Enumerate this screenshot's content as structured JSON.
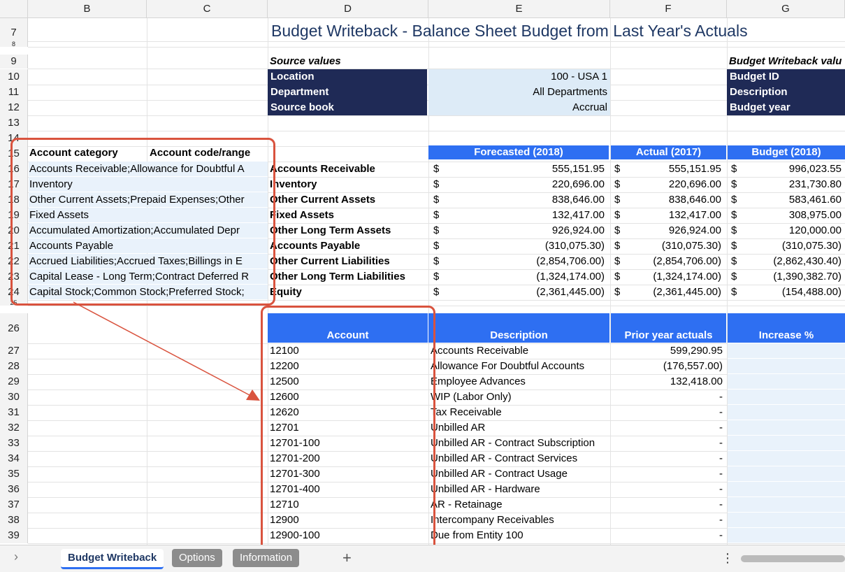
{
  "columns": [
    "B",
    "C",
    "D",
    "E",
    "F",
    "G"
  ],
  "rows": [
    "7",
    "8",
    "9",
    "10",
    "11",
    "12",
    "13",
    "14",
    "15",
    "16",
    "17",
    "18",
    "19",
    "20",
    "21",
    "22",
    "23",
    "24",
    "25",
    "26",
    "27",
    "28",
    "29",
    "30",
    "31",
    "32",
    "33",
    "34",
    "35",
    "36",
    "37",
    "38",
    "39"
  ],
  "title": "Budget Writeback - Balance Sheet Budget from Last Year's Actuals",
  "source": {
    "header": "Source values",
    "rows": [
      {
        "label": "Location",
        "value": "100 - USA 1"
      },
      {
        "label": "Department",
        "value": "All Departments"
      },
      {
        "label": "Source book",
        "value": "Accrual"
      }
    ]
  },
  "writeback": {
    "header": "Budget Writeback valu",
    "labels": [
      "Budget ID",
      "Description",
      "Budget year"
    ]
  },
  "category_table": {
    "headers": [
      "Account category",
      "Account code/range"
    ],
    "rows": [
      "Accounts Receivable;Allowance for Doubtful A",
      "Inventory",
      "Other Current Assets;Prepaid Expenses;Other",
      "Fixed Assets",
      "Accumulated Amortization;Accumulated Depr",
      "Accounts Payable",
      "Accrued Liabilities;Accrued Taxes;Billings in E",
      "Capital Lease - Long Term;Contract Deferred R",
      "Capital Stock;Common Stock;Preferred Stock;"
    ]
  },
  "summary_table": {
    "headers": [
      "Forecasted (2018)",
      "Actual (2017)",
      "Budget (2018)"
    ],
    "currency": "$",
    "rows": [
      {
        "label": "Accounts Receivable",
        "forecast": "555,151.95",
        "actual": "555,151.95",
        "budget": "996,023.55"
      },
      {
        "label": "Inventory",
        "forecast": "220,696.00",
        "actual": "220,696.00",
        "budget": "231,730.80"
      },
      {
        "label": "Other Current Assets",
        "forecast": "838,646.00",
        "actual": "838,646.00",
        "budget": "583,461.60"
      },
      {
        "label": "Fixed Assets",
        "forecast": "132,417.00",
        "actual": "132,417.00",
        "budget": "308,975.00"
      },
      {
        "label": "Other Long Term Assets",
        "forecast": "926,924.00",
        "actual": "926,924.00",
        "budget": "120,000.00"
      },
      {
        "label": "Accounts Payable",
        "forecast": "(310,075.30)",
        "actual": "(310,075.30)",
        "budget": "(310,075.30)"
      },
      {
        "label": "Other Current Liabilities",
        "forecast": "(2,854,706.00)",
        "actual": "(2,854,706.00)",
        "budget": "(2,862,430.40)"
      },
      {
        "label": "Other Long Term Liabilities",
        "forecast": "(1,324,174.00)",
        "actual": "(1,324,174.00)",
        "budget": "(1,390,382.70)"
      },
      {
        "label": "Equity",
        "forecast": "(2,361,445.00)",
        "actual": "(2,361,445.00)",
        "budget": "(154,488.00)"
      }
    ]
  },
  "account_table": {
    "headers": [
      "Account",
      "Description",
      "Prior year actuals",
      "Increase %"
    ],
    "rows": [
      {
        "account": "12100",
        "description": "Accounts Receivable",
        "prior": "599,290.95"
      },
      {
        "account": "12200",
        "description": "Allowance For Doubtful Accounts",
        "prior": "(176,557.00)"
      },
      {
        "account": "12500",
        "description": "Employee Advances",
        "prior": "132,418.00"
      },
      {
        "account": "12600",
        "description": "WIP (Labor Only)",
        "prior": "-"
      },
      {
        "account": "12620",
        "description": "Tax Receivable",
        "prior": "-"
      },
      {
        "account": "12701",
        "description": "Unbilled AR",
        "prior": "-"
      },
      {
        "account": "12701-100",
        "description": "Unbilled AR - Contract Subscription",
        "prior": "-"
      },
      {
        "account": "12701-200",
        "description": "Unbilled AR - Contract Services",
        "prior": "-"
      },
      {
        "account": "12701-300",
        "description": "Unbilled AR - Contract Usage",
        "prior": "-"
      },
      {
        "account": "12701-400",
        "description": "Unbilled AR - Hardware",
        "prior": "-"
      },
      {
        "account": "12710",
        "description": "AR - Retainage",
        "prior": "-"
      },
      {
        "account": "12900",
        "description": "Intercompany Receivables",
        "prior": "-"
      },
      {
        "account": "12900-100",
        "description": "Due from Entity 100",
        "prior": "-"
      }
    ]
  },
  "sheet_tabs": [
    "Budget Writeback",
    "Options",
    "Information"
  ],
  "add_sheet": "+",
  "nav_arrow": "›",
  "more": "⋮",
  "colors": {
    "accent": "#2e6ff2",
    "navy": "#1f2a56",
    "annotation": "#d9533e",
    "title": "#1f3864"
  }
}
